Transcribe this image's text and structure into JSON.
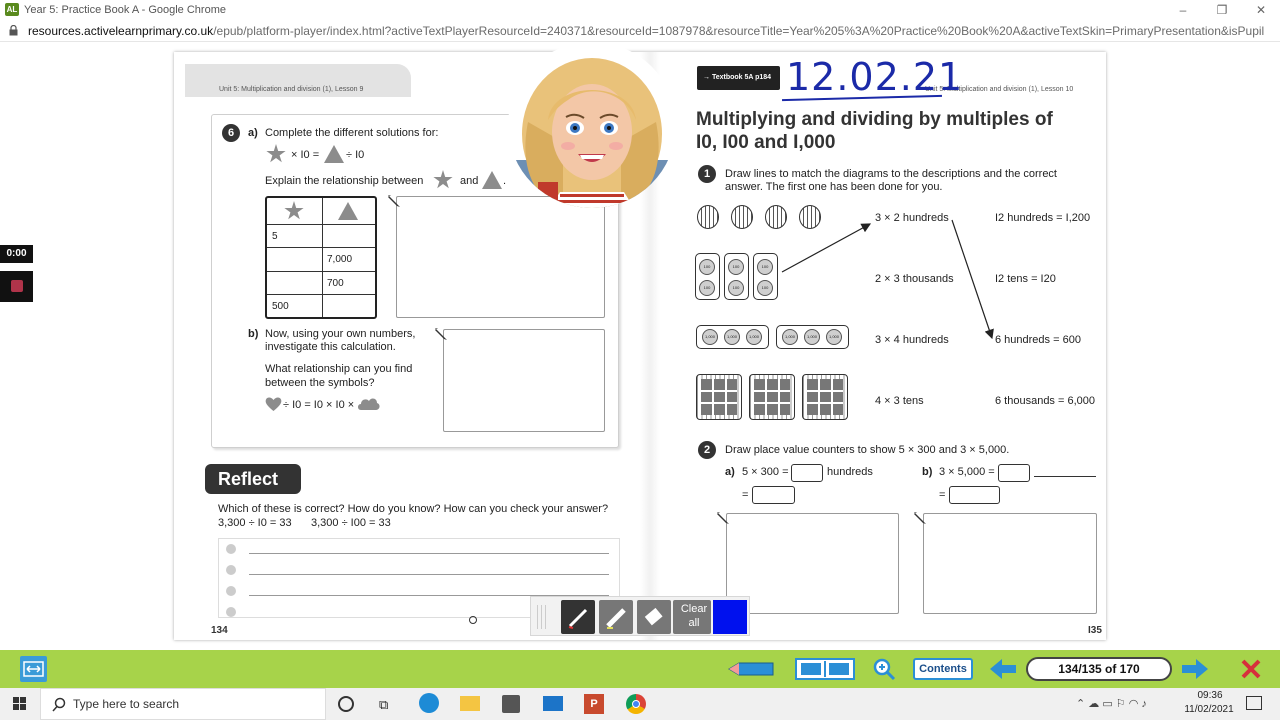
{
  "browser": {
    "title": "Year 5: Practice Book A - Google Chrome",
    "app_icon": "AL",
    "url_domain": "resources.activelearnprimary.co.uk",
    "url_path": "/epub/platform-player/index.html?activeTextPlayerResourceId=240371&resourceId=1087978&resourceTitle=Year%205%3A%20Practice%20Book%20A&activeTextSkin=PrimaryPresentation&isPupil=false&..."
  },
  "recorder": {
    "timer": "0:00"
  },
  "left_page": {
    "header": "Unit 5: Multiplication and division (1), Lesson 9",
    "page_number": "134",
    "q6": {
      "number": "6",
      "a_label": "a)",
      "a_text": "Complete the different solutions for:",
      "eq_part1": "× I0 =",
      "eq_part2": "÷ I0",
      "explain": "Explain the relationship between",
      "and": "and",
      "table_rows": [
        [
          "5",
          ""
        ],
        [
          "",
          "7,000"
        ],
        [
          "",
          "700"
        ],
        [
          "500",
          ""
        ]
      ],
      "b_label": "b)",
      "b_text1": "Now, using your own numbers,",
      "b_text2": "investigate this calculation.",
      "rel_text1": "What relationship can you find",
      "rel_text2": "between the symbols?",
      "eq_b": "÷ I0 = I0 × I0 ×"
    },
    "reflect": {
      "title": "Reflect",
      "question": "Which of these is correct? How do you know? How can you check your answer?",
      "eq1": "3,300 ÷ I0 = 33",
      "eq2": "3,300 ÷ I00 = 33"
    }
  },
  "right_page": {
    "header": "Unit 5: Multiplication and division (1), Lesson 10",
    "textbook_tag": "→ Textbook 5A p184",
    "handwritten_date": "12.02.21",
    "title_line1": "Multiplying and dividing by multiples of",
    "title_line2": "I0, I00 and I,000",
    "page_number": "I35",
    "q1": {
      "number": "1",
      "text_line1": "Draw lines to match the diagrams to the descriptions and the correct",
      "text_line2": "answer. The first one has been done for you.",
      "descriptions": [
        "3 × 2 hundreds",
        "2 × 3 thousands",
        "3 × 4 hundreds",
        "4 × 3 tens"
      ],
      "answers": [
        "I2 hundreds = I,200",
        "I2 tens = I20",
        "6 hundreds = 600",
        "6 thousands = 6,000"
      ],
      "coin_100": "100",
      "coin_1000": "1,000"
    },
    "q2": {
      "number": "2",
      "text": "Draw place value counters to show 5 × 300 and 3 × 5,000.",
      "a_label": "a)",
      "a_eq": "5 × 300 =",
      "a_unit": "hundreds",
      "b_label": "b)",
      "b_eq": "3 × 5,000 =",
      "equals": "="
    }
  },
  "draw_toolbar": {
    "clear_label_1": "Clear",
    "clear_label_2": "all",
    "pen_color": "#0011ee"
  },
  "player_bar": {
    "contents_label": "Contents",
    "page_indicator": "134/135 of 170"
  },
  "taskbar": {
    "search_placeholder": "Type here to search",
    "time": "09:36",
    "date": "11/02/2021"
  }
}
